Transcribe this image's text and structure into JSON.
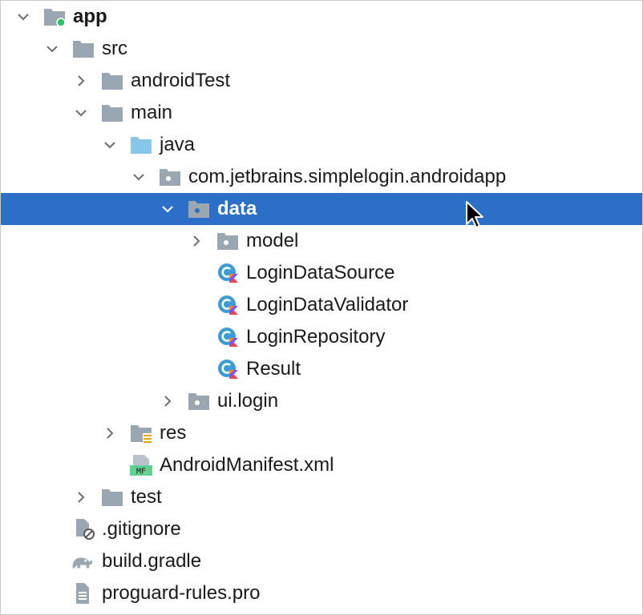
{
  "tree": {
    "app": "app",
    "src": "src",
    "android_test": "androidTest",
    "main": "main",
    "java": "java",
    "package": "com.jetbrains.simplelogin.androidapp",
    "data": "data",
    "model": "model",
    "login_data_source": "LoginDataSource",
    "login_data_validator": "LoginDataValidator",
    "login_repository": "LoginRepository",
    "result": "Result",
    "ui_login": "ui.login",
    "res": "res",
    "manifest": "AndroidManifest.xml",
    "manifest_badge": "MF",
    "test": "test",
    "gitignore": ".gitignore",
    "build_gradle": "build.gradle",
    "proguard": "proguard-rules.pro"
  },
  "colors": {
    "selection": "#2b6fc7",
    "folder": "#9aa7b0",
    "source_folder": "#87c6e8",
    "kotlin_class": "#3d9bd6"
  }
}
